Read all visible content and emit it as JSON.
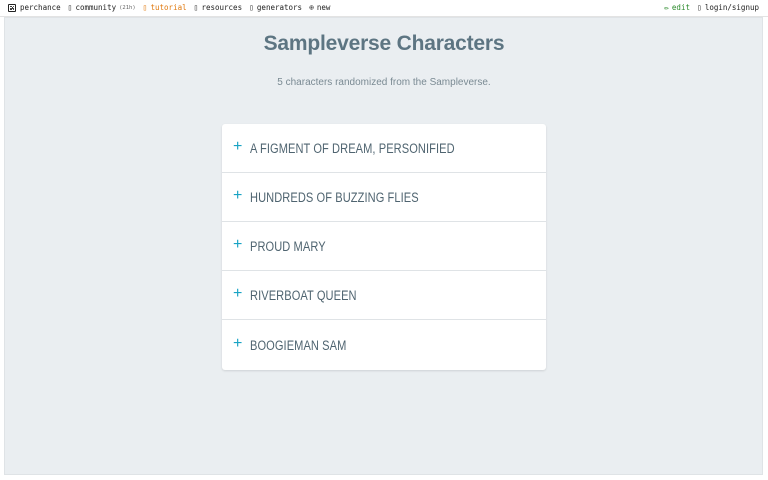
{
  "topnav": {
    "brand": "perchance",
    "community": "community",
    "community_count": "(21h)",
    "tutorial": "tutorial",
    "resources": "resources",
    "generators": "generators",
    "new": "new",
    "edit": "edit",
    "login": "login/signup"
  },
  "page": {
    "title": "Sampleverse Characters",
    "subtitle": "5 characters randomized from the Sampleverse."
  },
  "characters": [
    {
      "label": "A FIGMENT OF DREAM, PERSONIFIED"
    },
    {
      "label": "HUNDREDS OF BUZZING FLIES"
    },
    {
      "label": "PROUD MARY"
    },
    {
      "label": "RIVERBOAT QUEEN"
    },
    {
      "label": "BOOGIEMAN SAM"
    }
  ],
  "icons": {
    "expand": "plus-icon",
    "brand": "dice-icon"
  },
  "colors": {
    "accent": "#19a3c4",
    "title": "#5d7582",
    "background": "#eaeef1",
    "tutorial": "#e07a10",
    "edit": "#2a8a2a"
  }
}
